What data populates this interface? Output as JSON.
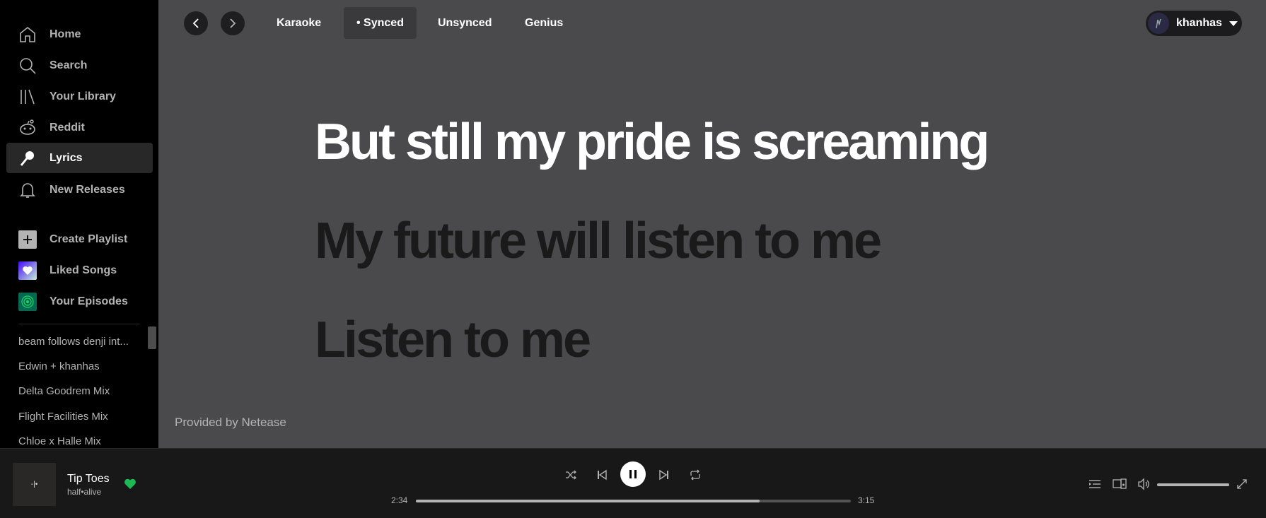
{
  "sidebar": {
    "nav": [
      {
        "label": "Home",
        "icon": "home-icon"
      },
      {
        "label": "Search",
        "icon": "search-icon"
      },
      {
        "label": "Your Library",
        "icon": "library-icon"
      },
      {
        "label": "Reddit",
        "icon": "reddit-icon"
      },
      {
        "label": "Lyrics",
        "icon": "microphone-icon",
        "active": true
      },
      {
        "label": "New Releases",
        "icon": "bell-icon"
      }
    ],
    "library": [
      {
        "label": "Create Playlist",
        "icon": "plus-icon"
      },
      {
        "label": "Liked Songs",
        "icon": "heart-icon"
      },
      {
        "label": "Your Episodes",
        "icon": "podcast-icon"
      }
    ],
    "playlists": [
      "beam follows denji int...",
      "Edwin + khanhas",
      "Delta Goodrem Mix",
      "Flight Facilities Mix",
      "Chloe x Halle Mix"
    ]
  },
  "topbar": {
    "tabs": [
      "Karaoke",
      "• Synced",
      "Unsynced",
      "Genius"
    ],
    "active_tab": 1,
    "user": "khanhas"
  },
  "lyrics": {
    "current": "But still my pride is screaming",
    "next1": "My future will listen to me",
    "next2": "Listen to me",
    "provider": "Provided by Netease"
  },
  "player": {
    "title": "Tip Toes",
    "artist": "half•alive",
    "album_art_text": "-|•",
    "elapsed": "2:34",
    "duration": "3:15",
    "progress_fraction": 0.79,
    "volume_fraction": 1.0,
    "liked": true
  },
  "colors": {
    "accent": "#1db954",
    "main_bg": "#4a4a4d",
    "lyric_current": "#ffffff",
    "lyric_upcoming": "#1a1a1a"
  }
}
